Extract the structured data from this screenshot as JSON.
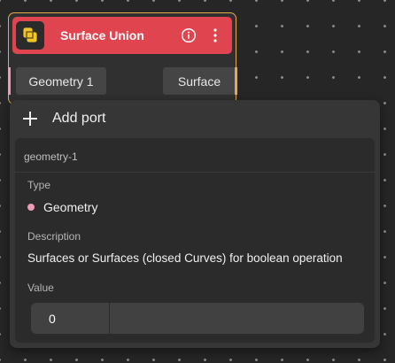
{
  "node": {
    "title": "Surface Union",
    "icon": "surface-union-icon",
    "info_icon": "info-icon",
    "menu_icon": "more-vertical-icon",
    "header_color": "#e0454f",
    "border_color": "#e5a94d",
    "input_port": {
      "label": "Geometry 1",
      "color": "#ee9ab4"
    },
    "output_port": {
      "label": "Surface",
      "color": "#e5a94d"
    }
  },
  "panel": {
    "add_port_label": "Add port",
    "add_icon": "plus-icon",
    "port": {
      "id": "geometry-1",
      "type_label": "Type",
      "type_value": "Geometry",
      "type_color": "#ee9ab4",
      "description_label": "Description",
      "description_value": "Surfaces or Surfaces (closed Curves) for boolean operation",
      "value_label": "Value",
      "value": "0"
    }
  }
}
